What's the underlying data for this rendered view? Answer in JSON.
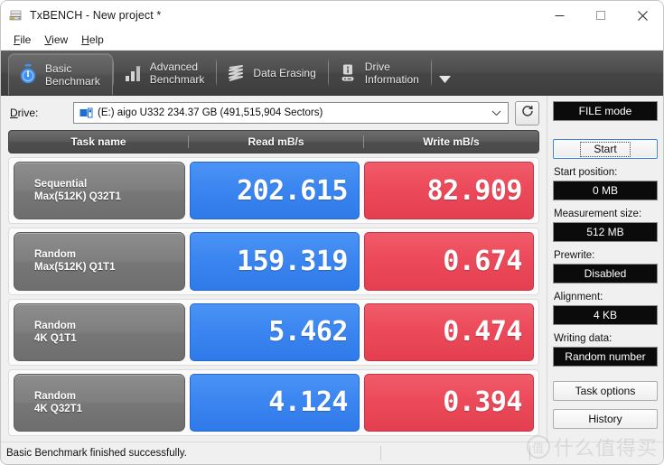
{
  "window": {
    "title": "TxBENCH - New project *",
    "icon": "drive-stack-icon",
    "controls": {
      "minimize": "minimize-icon",
      "maximize": "maximize-icon",
      "close": "close-icon"
    }
  },
  "menu": [
    {
      "label": "File",
      "accel": "F"
    },
    {
      "label": "View",
      "accel": "V"
    },
    {
      "label": "Help",
      "accel": "H"
    }
  ],
  "tabs": [
    {
      "label": "Basic\nBenchmark",
      "icon": "stopwatch-icon",
      "active": true
    },
    {
      "label": "Advanced\nBenchmark",
      "icon": "bar-chart-icon",
      "active": false
    },
    {
      "label": "Data Erasing",
      "icon": "shredder-icon",
      "active": false
    },
    {
      "label": "Drive\nInformation",
      "icon": "drive-info-icon",
      "active": false
    }
  ],
  "tab_overflow_icon": "chevron-down-icon",
  "drive": {
    "label": "Drive:",
    "selected": "(E:) aigo U332  234.37 GB (491,515,904 Sectors)",
    "icon": "drive-icon",
    "dropdown_icon": "chevron-down-icon",
    "refresh_icon": "refresh-icon"
  },
  "results": {
    "columns": [
      "Task name",
      "Read mB/s",
      "Write mB/s"
    ],
    "rows": [
      {
        "task": "Sequential\nMax(512K) Q32T1",
        "read": "202.615",
        "write": "82.909"
      },
      {
        "task": "Random\nMax(512K) Q1T1",
        "read": "159.319",
        "write": "0.674"
      },
      {
        "task": "Random\n4K Q1T1",
        "read": "5.462",
        "write": "0.474"
      },
      {
        "task": "Random\n4K Q32T1",
        "read": "4.124",
        "write": "0.394"
      }
    ]
  },
  "sidebar": {
    "mode_button": "FILE mode",
    "start_button": "Start",
    "fields": [
      {
        "label": "Start position:",
        "value": "0 MB"
      },
      {
        "label": "Measurement size:",
        "value": "512 MB"
      },
      {
        "label": "Prewrite:",
        "value": "Disabled"
      },
      {
        "label": "Alignment:",
        "value": "4 KB"
      },
      {
        "label": "Writing data:",
        "value": "Random number"
      }
    ],
    "task_options_button": "Task options",
    "history_button": "History"
  },
  "statusbar": {
    "message": "Basic Benchmark finished successfully.",
    "segment2": "",
    "segment3": ""
  },
  "colors": {
    "read_chip": "#3b86f0",
    "write_chip": "#ec4a5a",
    "tab_strip": "#4d4d4d",
    "accent_focus": "#3a86d8"
  }
}
